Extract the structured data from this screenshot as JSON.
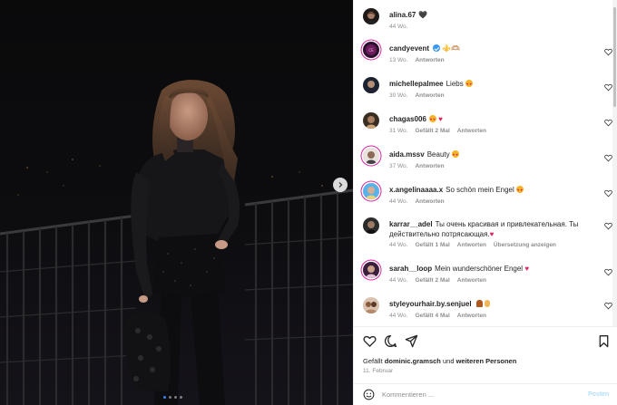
{
  "post": {
    "author": {
      "username": "alina.67",
      "heart": "🖤",
      "time": "44 Wo."
    },
    "carousel": {
      "total": 4,
      "active": 0
    }
  },
  "comments": [
    {
      "username": "candyevent",
      "verified": true,
      "text": "⚜️🫶🏼",
      "time": "13 Wo.",
      "likes": "",
      "reply": "Antworten",
      "translate": ""
    },
    {
      "username": "michellepalmee",
      "verified": false,
      "text": "Liebs",
      "time": "30 Wo.",
      "likes": "",
      "reply": "Antworten",
      "translate": ""
    },
    {
      "username": "chagas006",
      "verified": false,
      "text": "",
      "time": "31 Wo.",
      "likes": "Gefällt 2 Mal",
      "reply": "Antworten",
      "translate": ""
    },
    {
      "username": "aida.mssv",
      "verified": false,
      "text": "Beauty",
      "time": "37 Wo.",
      "likes": "",
      "reply": "Antworten",
      "translate": ""
    },
    {
      "username": "x.angelinaaaa.x",
      "verified": false,
      "text": "So schön mein Engel",
      "time": "44 Wo.",
      "likes": "",
      "reply": "Antworten",
      "translate": ""
    },
    {
      "username": "karrar__adel",
      "verified": false,
      "text": "Ты очень красивая и привлекательная. Ты действительно потрясающая.",
      "time": "44 Wo.",
      "likes": "Gefällt 1 Mal",
      "reply": "Antworten",
      "translate": "Übersetzung anzeigen"
    },
    {
      "username": "sarah__loop",
      "verified": false,
      "text": "Mein wunderschöner Engel",
      "time": "44 Wo.",
      "likes": "Gefällt 2 Mal",
      "reply": "Antworten",
      "translate": ""
    },
    {
      "username": "styleyourhair.by.senjuel",
      "verified": false,
      "text": "",
      "time": "44 Wo.",
      "likes": "Gefällt 4 Mal",
      "reply": "Antworten",
      "translate": ""
    }
  ],
  "footer": {
    "liked_prefix": "Gefällt",
    "liked_user": "dominic.gramsch",
    "liked_and": "und",
    "liked_others": "weiteren Personen",
    "date": "11. Februar",
    "comment_placeholder": "Kommentieren ...",
    "post_label": "Posten"
  },
  "icons": {
    "like": "heart-outline-icon",
    "comment": "comment-bubble-icon",
    "share": "paper-plane-icon",
    "save": "bookmark-icon",
    "emoji": "smiley-icon",
    "next": "chevron-right-icon"
  },
  "colors": {
    "accent": "#3897f0",
    "heart_red": "#e0245e",
    "muted": "#8e8e8e",
    "post_disabled": "#b2dffc"
  }
}
